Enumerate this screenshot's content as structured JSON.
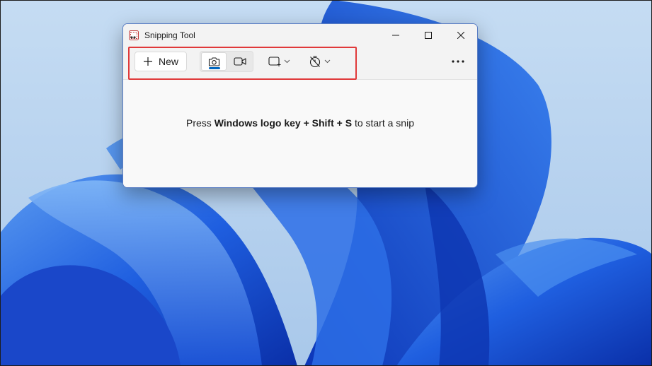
{
  "window": {
    "title": "Snipping Tool",
    "controls": [
      "minimize-icon",
      "maximize-icon",
      "close-icon"
    ]
  },
  "toolbar": {
    "new_label": "New",
    "new_icon": "plus-icon",
    "modes": [
      {
        "icon": "camera-icon",
        "selected": true
      },
      {
        "icon": "video-icon",
        "selected": false
      }
    ],
    "snip_shape_icon": "rectangle-snip-icon",
    "timer_icon": "no-delay-timer-icon",
    "more_icon": "more-icon"
  },
  "content": {
    "hint_prefix": "Press",
    "hint_keys": "Windows logo key + Shift + S",
    "hint_suffix": "to start a snip"
  },
  "colors": {
    "accent": "#0067c0",
    "highlight_box": "#e0393a",
    "wallpaper_blue": "#1f56d6"
  }
}
